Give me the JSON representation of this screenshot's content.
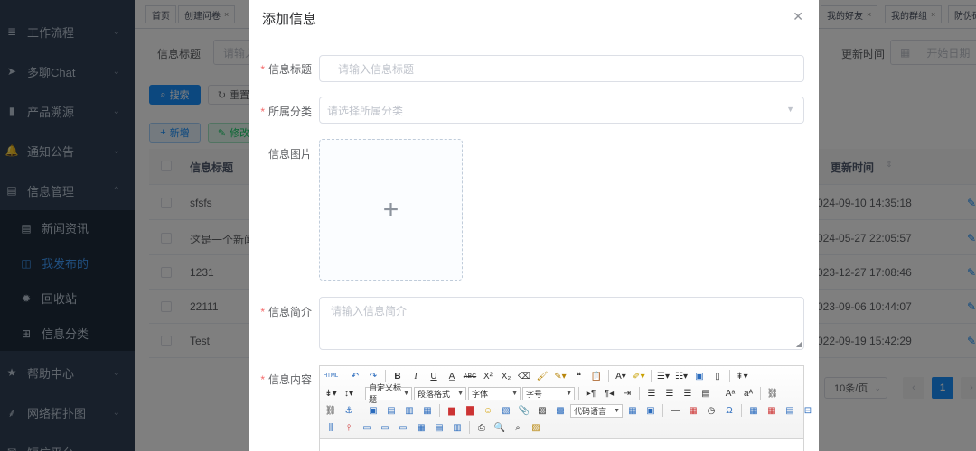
{
  "sidebar": {
    "items": [
      {
        "label": "工作流程",
        "icon": "workflow-icon",
        "glyph": "≣"
      },
      {
        "label": "多聊Chat",
        "icon": "send-icon",
        "glyph": "➤"
      },
      {
        "label": "产品溯源",
        "icon": "book-icon",
        "glyph": "▮"
      },
      {
        "label": "通知公告",
        "icon": "bell-icon",
        "glyph": "🔔"
      },
      {
        "label": "信息管理",
        "icon": "document-icon",
        "glyph": "▤"
      }
    ],
    "subitems": [
      {
        "label": "新闻资讯",
        "icon": "news-icon",
        "glyph": "▤"
      },
      {
        "label": "我发布的",
        "icon": "table-icon",
        "glyph": "◫"
      },
      {
        "label": "回收站",
        "icon": "bug-icon",
        "glyph": "✹"
      },
      {
        "label": "信息分类",
        "icon": "grid-icon",
        "glyph": "⊞"
      }
    ],
    "bottom_items": [
      {
        "label": "帮助中心",
        "icon": "star-icon",
        "glyph": "★"
      },
      {
        "label": "网络拓扑图",
        "icon": "tree-icon",
        "glyph": "⸙"
      },
      {
        "label": "短信平台",
        "icon": "message-icon",
        "glyph": "✉"
      }
    ]
  },
  "tags": {
    "home": "首页",
    "create_survey": "创建问卷",
    "my_friends": "我的好友",
    "my_groups": "我的群组",
    "anti_counterfeit": "防伪码"
  },
  "search": {
    "title_label": "信息标题",
    "title_placeholder": "请输入",
    "update_time_label": "更新时间",
    "start_date_placeholder": "开始日期",
    "search_button": "搜索",
    "reset_button": "重置",
    "add_button": "新增",
    "edit_button": "修改"
  },
  "table": {
    "headers": {
      "title": "信息标题",
      "update_time": "更新时间"
    },
    "rows": [
      {
        "title": "sfsfs",
        "time": "024-09-10 14:35:18"
      },
      {
        "title": "这是一个新闻",
        "time": "024-05-27 22:05:57"
      },
      {
        "title": "1231",
        "time": "023-12-27 17:08:46"
      },
      {
        "title": "22111",
        "time": "023-09-06 10:44:07"
      },
      {
        "title": "Test",
        "time": "022-09-19 15:42:29"
      }
    ]
  },
  "pagination": {
    "page_size": "10条/页",
    "current_page": "1"
  },
  "dialog": {
    "title": "添加信息",
    "fields": {
      "title_label": "信息标题",
      "title_placeholder": "请输入信息标题",
      "category_label": "所属分类",
      "category_placeholder": "请选择所属分类",
      "image_label": "信息图片",
      "summary_label": "信息简介",
      "summary_placeholder": "请输入信息简介",
      "content_label": "信息内容"
    },
    "editor": {
      "custom_title": "自定义标题",
      "paragraph_format": "段落格式",
      "font": "字体",
      "font_size": "字号",
      "code_language": "代码语言"
    }
  }
}
